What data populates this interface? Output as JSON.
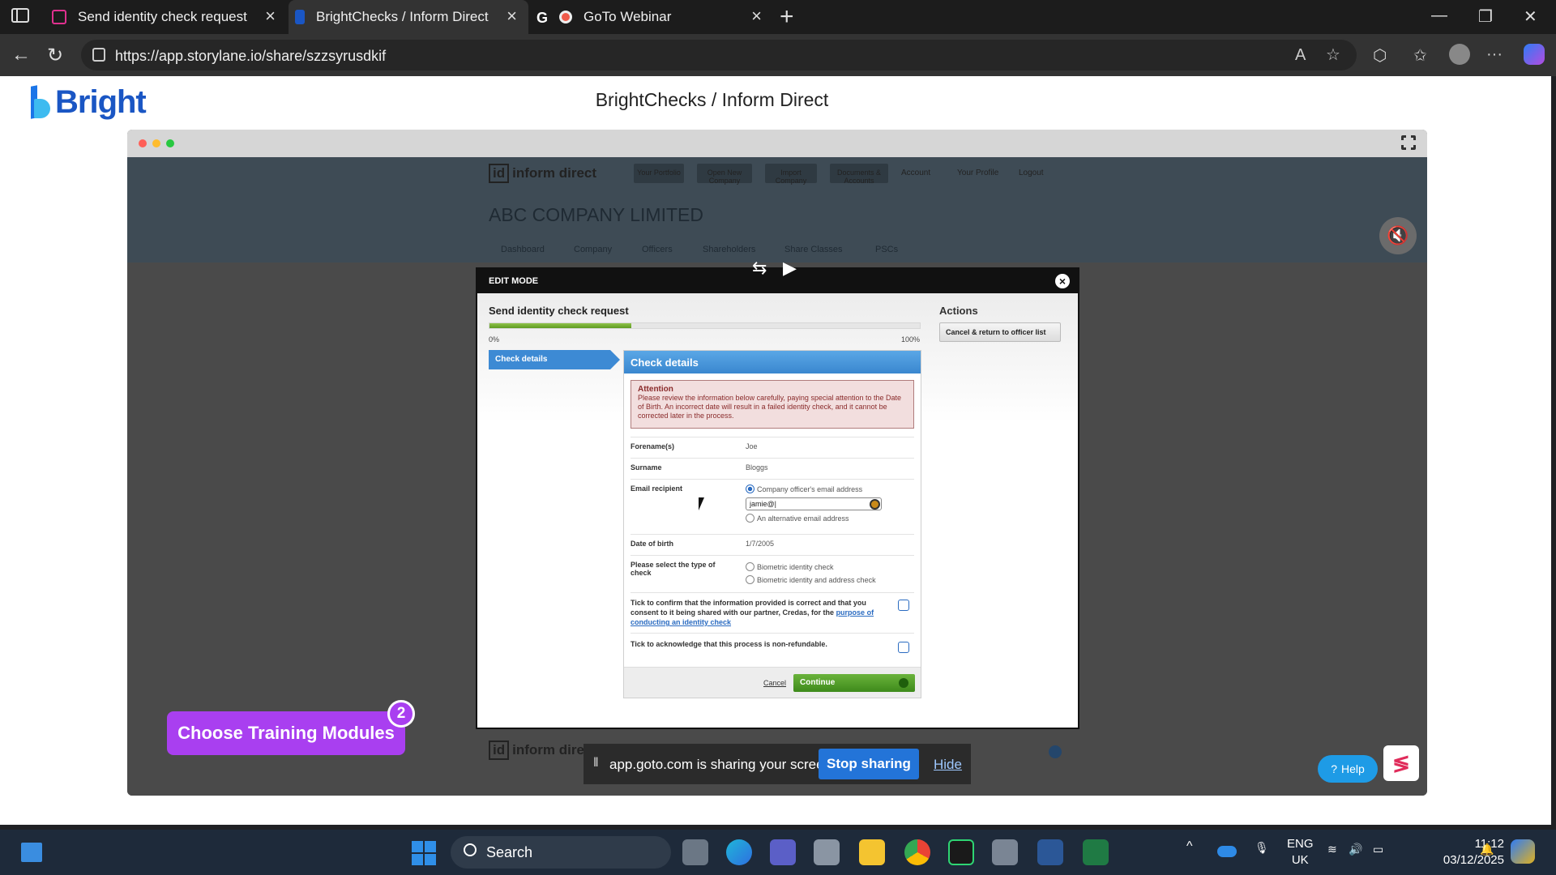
{
  "browser": {
    "tabs": [
      {
        "title": "Send identity check request",
        "favicon_color": "#e0308f"
      },
      {
        "title": "BrightChecks / Inform Direct",
        "favicon_color": "#1a56c4"
      },
      {
        "title": "GoTo Webinar",
        "favicon_color": "#f05a4a"
      }
    ],
    "url": "https://app.storylane.io/share/szzsyrusdkif"
  },
  "page": {
    "brand": "Bright",
    "title": "BrightChecks / Inform Direct"
  },
  "app": {
    "logo": "inform direct",
    "menu": [
      "Your Portfolio",
      "Open New Company",
      "Import Company",
      "Documents & Accounts"
    ],
    "account": "Account",
    "profile": "Your Profile",
    "logout": "Logout",
    "company": "ABC COMPANY LIMITED",
    "subnav": [
      "Dashboard",
      "Company",
      "Officers",
      "Shareholders",
      "Share Classes",
      "PSCs"
    ]
  },
  "modal": {
    "header": "EDIT MODE",
    "form_title": "Send identity check request",
    "progress_percent": 33,
    "progress_min": "0%",
    "progress_max": "100%",
    "step": "Check details",
    "panel_title": "Check details",
    "attention_title": "Attention",
    "attention_text": "Please review the information below carefully, paying special attention to the Date of Birth. An incorrect date will result in a failed identity check, and it cannot be corrected later in the process.",
    "fields": {
      "forename_label": "Forename(s)",
      "forename_value": "Joe",
      "surname_label": "Surname",
      "surname_value": "Bloggs",
      "email_label": "Email recipient",
      "email_option1": "Company officer's email address",
      "email_value": "jamie@|",
      "email_option2": "An alternative email address",
      "dob_label": "Date of birth",
      "dob_value": "1/7/2005",
      "type_label": "Please select the type of check",
      "type_option1": "Biometric identity check",
      "type_option2": "Biometric identity and address check",
      "consent_text": "Tick to confirm that the information provided is correct and that you consent to it being shared with our partner, Credas, for the",
      "consent_link": "purpose of conducting an identity check",
      "refund_text": "Tick to acknowledge that this process is non-refundable."
    },
    "cancel": "Cancel",
    "continue": "Continue",
    "actions_title": "Actions",
    "cancel_return": "Cancel & return to officer list"
  },
  "overlays": {
    "training": "Choose Training Modules",
    "training_badge": "2",
    "share_text": "app.goto.com is sharing your screen.",
    "stop_sharing": "Stop sharing",
    "hide": "Hide",
    "help": "Help"
  },
  "taskbar": {
    "search": "Search",
    "lang1": "ENG",
    "lang2": "UK",
    "time": "11:12",
    "date": "03/12/2025"
  }
}
